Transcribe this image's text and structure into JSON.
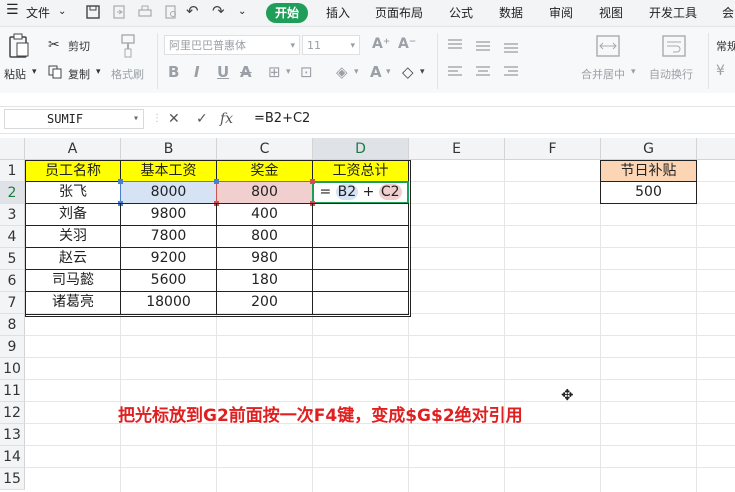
{
  "menubar": {
    "file_label": "文件",
    "tabs": [
      "开始",
      "插入",
      "页面布局",
      "公式",
      "数据",
      "审阅",
      "视图",
      "开发工具",
      "会"
    ]
  },
  "ribbon": {
    "paste": "粘贴",
    "cut": "剪切",
    "copy": "复制",
    "format_painter": "格式刷",
    "font_name": "阿里巴巴普惠体",
    "font_size": "11",
    "merge_center": "合并居中",
    "wrap_text": "自动换行",
    "number_format": "常规"
  },
  "formula_bar": {
    "name_box": "SUMIF",
    "fx_label": "fx",
    "formula": "=B2+C2"
  },
  "grid": {
    "columns": [
      "A",
      "B",
      "C",
      "D",
      "E",
      "F",
      "G"
    ],
    "rows": [
      "1",
      "2",
      "3",
      "4",
      "5",
      "6",
      "7",
      "8",
      "9",
      "10",
      "11",
      "12",
      "13",
      "14",
      "15"
    ],
    "headers": [
      "员工名称",
      "基本工资",
      "奖金",
      "工资总计"
    ],
    "data": [
      [
        "张飞",
        "8000",
        "800"
      ],
      [
        "刘备",
        "9800",
        "400"
      ],
      [
        "关羽",
        "7800",
        "800"
      ],
      [
        "赵云",
        "9200",
        "980"
      ],
      [
        "司马懿",
        "5600",
        "180"
      ],
      [
        "诸葛亮",
        "18000",
        "200"
      ]
    ],
    "editing_cell": {
      "eq": "=",
      "ref1": "B2",
      "op": "+",
      "ref2": "C2"
    },
    "allowance_header": "节日补贴",
    "allowance_value": "500"
  },
  "annotation": "把光标放到G2前面按一次F4键，变成$G$2绝对引用",
  "colors": {
    "accent_green": "#1f9e5a",
    "header_yellow": "#ffff00",
    "allowance_orange": "#fcd5b4",
    "ref_blue": "#d6e3f4",
    "ref_red": "#f2cfcf",
    "annotation_red": "#e02020"
  }
}
